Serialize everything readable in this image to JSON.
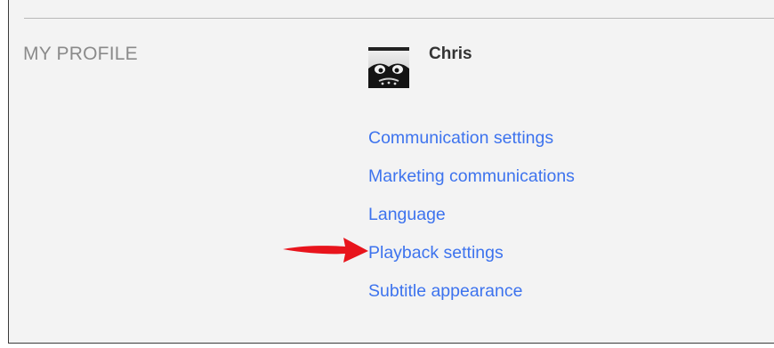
{
  "section": {
    "title": "MY PROFILE"
  },
  "profile": {
    "name": "Chris",
    "avatar_icon": "avatar-icon"
  },
  "links": [
    {
      "label": "Communication settings"
    },
    {
      "label": "Marketing communications"
    },
    {
      "label": "Language"
    },
    {
      "label": "Playback settings"
    },
    {
      "label": "Subtitle appearance"
    }
  ],
  "colors": {
    "link": "#3d73ee",
    "annotation_arrow": "#e8141c"
  }
}
